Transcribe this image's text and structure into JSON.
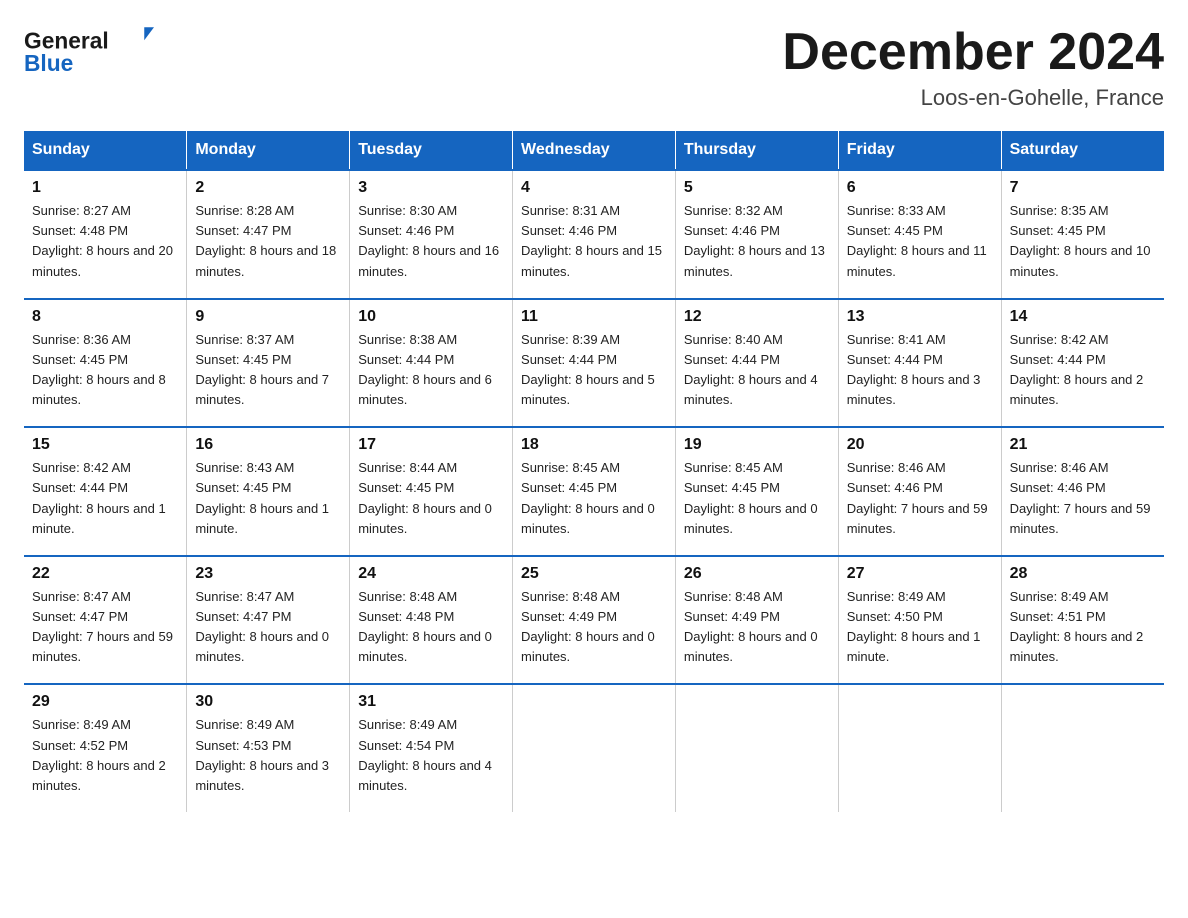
{
  "header": {
    "logo_line1": "General",
    "logo_line2": "Blue",
    "month_title": "December 2024",
    "location": "Loos-en-Gohelle, France"
  },
  "weekdays": [
    "Sunday",
    "Monday",
    "Tuesday",
    "Wednesday",
    "Thursday",
    "Friday",
    "Saturday"
  ],
  "weeks": [
    [
      {
        "day": "1",
        "sunrise": "8:27 AM",
        "sunset": "4:48 PM",
        "daylight": "8 hours and 20 minutes."
      },
      {
        "day": "2",
        "sunrise": "8:28 AM",
        "sunset": "4:47 PM",
        "daylight": "8 hours and 18 minutes."
      },
      {
        "day": "3",
        "sunrise": "8:30 AM",
        "sunset": "4:46 PM",
        "daylight": "8 hours and 16 minutes."
      },
      {
        "day": "4",
        "sunrise": "8:31 AM",
        "sunset": "4:46 PM",
        "daylight": "8 hours and 15 minutes."
      },
      {
        "day": "5",
        "sunrise": "8:32 AM",
        "sunset": "4:46 PM",
        "daylight": "8 hours and 13 minutes."
      },
      {
        "day": "6",
        "sunrise": "8:33 AM",
        "sunset": "4:45 PM",
        "daylight": "8 hours and 11 minutes."
      },
      {
        "day": "7",
        "sunrise": "8:35 AM",
        "sunset": "4:45 PM",
        "daylight": "8 hours and 10 minutes."
      }
    ],
    [
      {
        "day": "8",
        "sunrise": "8:36 AM",
        "sunset": "4:45 PM",
        "daylight": "8 hours and 8 minutes."
      },
      {
        "day": "9",
        "sunrise": "8:37 AM",
        "sunset": "4:45 PM",
        "daylight": "8 hours and 7 minutes."
      },
      {
        "day": "10",
        "sunrise": "8:38 AM",
        "sunset": "4:44 PM",
        "daylight": "8 hours and 6 minutes."
      },
      {
        "day": "11",
        "sunrise": "8:39 AM",
        "sunset": "4:44 PM",
        "daylight": "8 hours and 5 minutes."
      },
      {
        "day": "12",
        "sunrise": "8:40 AM",
        "sunset": "4:44 PM",
        "daylight": "8 hours and 4 minutes."
      },
      {
        "day": "13",
        "sunrise": "8:41 AM",
        "sunset": "4:44 PM",
        "daylight": "8 hours and 3 minutes."
      },
      {
        "day": "14",
        "sunrise": "8:42 AM",
        "sunset": "4:44 PM",
        "daylight": "8 hours and 2 minutes."
      }
    ],
    [
      {
        "day": "15",
        "sunrise": "8:42 AM",
        "sunset": "4:44 PM",
        "daylight": "8 hours and 1 minute."
      },
      {
        "day": "16",
        "sunrise": "8:43 AM",
        "sunset": "4:45 PM",
        "daylight": "8 hours and 1 minute."
      },
      {
        "day": "17",
        "sunrise": "8:44 AM",
        "sunset": "4:45 PM",
        "daylight": "8 hours and 0 minutes."
      },
      {
        "day": "18",
        "sunrise": "8:45 AM",
        "sunset": "4:45 PM",
        "daylight": "8 hours and 0 minutes."
      },
      {
        "day": "19",
        "sunrise": "8:45 AM",
        "sunset": "4:45 PM",
        "daylight": "8 hours and 0 minutes."
      },
      {
        "day": "20",
        "sunrise": "8:46 AM",
        "sunset": "4:46 PM",
        "daylight": "7 hours and 59 minutes."
      },
      {
        "day": "21",
        "sunrise": "8:46 AM",
        "sunset": "4:46 PM",
        "daylight": "7 hours and 59 minutes."
      }
    ],
    [
      {
        "day": "22",
        "sunrise": "8:47 AM",
        "sunset": "4:47 PM",
        "daylight": "7 hours and 59 minutes."
      },
      {
        "day": "23",
        "sunrise": "8:47 AM",
        "sunset": "4:47 PM",
        "daylight": "8 hours and 0 minutes."
      },
      {
        "day": "24",
        "sunrise": "8:48 AM",
        "sunset": "4:48 PM",
        "daylight": "8 hours and 0 minutes."
      },
      {
        "day": "25",
        "sunrise": "8:48 AM",
        "sunset": "4:49 PM",
        "daylight": "8 hours and 0 minutes."
      },
      {
        "day": "26",
        "sunrise": "8:48 AM",
        "sunset": "4:49 PM",
        "daylight": "8 hours and 0 minutes."
      },
      {
        "day": "27",
        "sunrise": "8:49 AM",
        "sunset": "4:50 PM",
        "daylight": "8 hours and 1 minute."
      },
      {
        "day": "28",
        "sunrise": "8:49 AM",
        "sunset": "4:51 PM",
        "daylight": "8 hours and 2 minutes."
      }
    ],
    [
      {
        "day": "29",
        "sunrise": "8:49 AM",
        "sunset": "4:52 PM",
        "daylight": "8 hours and 2 minutes."
      },
      {
        "day": "30",
        "sunrise": "8:49 AM",
        "sunset": "4:53 PM",
        "daylight": "8 hours and 3 minutes."
      },
      {
        "day": "31",
        "sunrise": "8:49 AM",
        "sunset": "4:54 PM",
        "daylight": "8 hours and 4 minutes."
      },
      null,
      null,
      null,
      null
    ]
  ]
}
